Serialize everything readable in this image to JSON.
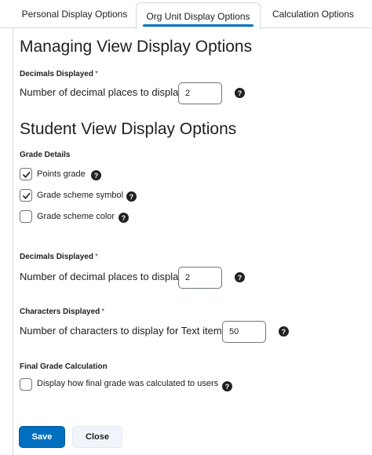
{
  "tabs": [
    {
      "label": "Personal Display Options",
      "active": false
    },
    {
      "label": "Org Unit Display Options",
      "active": true
    },
    {
      "label": "Calculation Options",
      "active": false
    }
  ],
  "managing": {
    "heading": "Managing View Display Options",
    "decimals_label": "Decimals Displayed",
    "required_mark": "*",
    "decimals_text": "Number of decimal places to display",
    "decimals_value": "2"
  },
  "student": {
    "heading": "Student View Display Options",
    "grade_details_label": "Grade Details",
    "checkboxes": [
      {
        "label": "Points grade",
        "checked": true
      },
      {
        "label": "Grade scheme symbol",
        "checked": true
      },
      {
        "label": "Grade scheme color",
        "checked": false
      }
    ],
    "decimals_label": "Decimals Displayed",
    "decimals_text": "Number of decimal places to display",
    "decimals_value": "2",
    "characters_label": "Characters Displayed",
    "characters_text": "Number of characters to display for Text items",
    "characters_value": "50",
    "final_label": "Final Grade Calculation",
    "final_checkbox_label": "Display how final grade was calculated to users",
    "final_checked": false
  },
  "help_glyph": "?",
  "buttons": {
    "save": "Save",
    "close": "Close"
  },
  "colors": {
    "primary": "#006fbf",
    "border": "#d3d9e3",
    "text": "#202122"
  }
}
